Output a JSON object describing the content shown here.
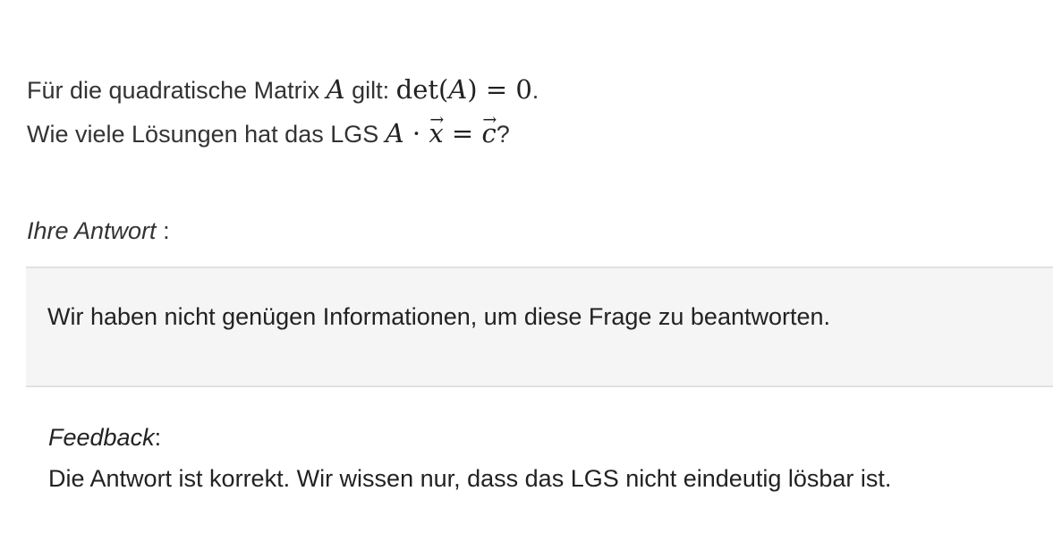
{
  "question": {
    "line1_prefix": "Für die quadratische Matrix ",
    "matrix_symbol": "A",
    "line1_middle": " gilt: ",
    "det_function": "det",
    "det_open": "(",
    "det_arg": "A",
    "det_close_equals": ") = 0",
    "line1_end": ".",
    "line2_prefix": "Wie viele Lösungen hat das LGS ",
    "eq_A": "A",
    "eq_dot": " · ",
    "eq_x": "x",
    "eq_equals": " = ",
    "eq_c": "c",
    "line2_end": "?"
  },
  "answer": {
    "label": "Ihre Antwort",
    "label_suffix": " :",
    "text": "Wir haben nicht genügen Informationen, um diese Frage zu beantworten."
  },
  "feedback": {
    "label": "Feedback",
    "label_suffix": ":",
    "text": "Die Antwort ist korrekt. Wir wissen nur, dass das LGS nicht eindeutig lösbar ist."
  }
}
